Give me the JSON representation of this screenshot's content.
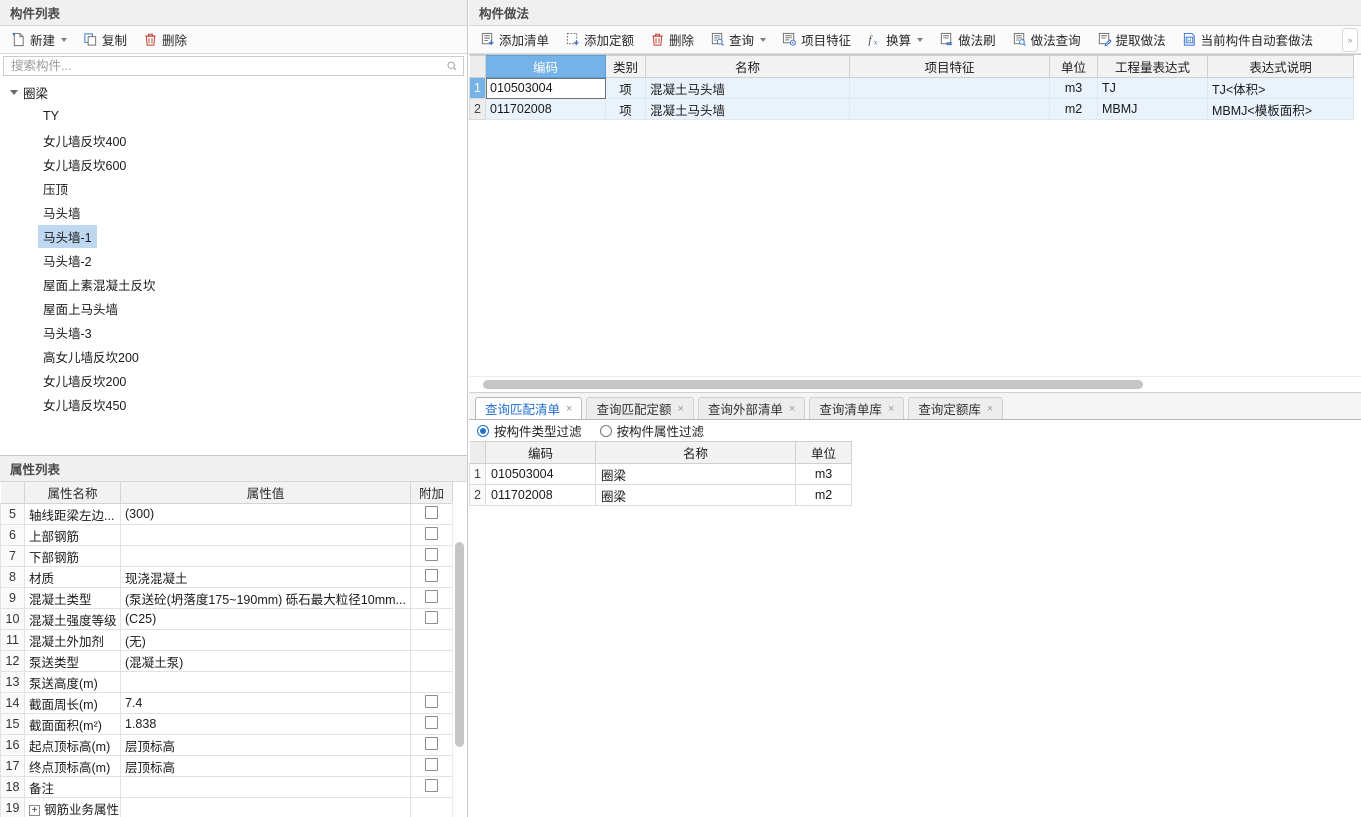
{
  "component_list": {
    "title": "构件列表",
    "toolbar": [
      {
        "label": "新建",
        "icon": "new-file-icon",
        "caret": true
      },
      {
        "label": "复制",
        "icon": "copy-icon",
        "caret": false
      },
      {
        "label": "删除",
        "icon": "trash-icon",
        "caret": false
      }
    ],
    "search": {
      "placeholder": "搜索构件...",
      "value": "",
      "icon": "search-icon"
    },
    "tree": {
      "root": "圈梁",
      "items": [
        "TY",
        "女儿墙反坎400",
        "女儿墙反坎600",
        "压顶",
        "马头墙",
        "马头墙-1",
        "马头墙-2",
        "屋面上素混凝土反坎",
        "屋面上马头墙",
        "马头墙-3",
        "高女儿墙反坎200",
        "女儿墙反坎200",
        "女儿墙反坎450"
      ],
      "selected_index": 5
    }
  },
  "property_list": {
    "title": "属性列表",
    "headers": [
      "",
      "属性名称",
      "属性值",
      "附加"
    ],
    "rows": [
      {
        "idx": "5",
        "name": "轴线距梁左边...",
        "link": false,
        "value": "(300)",
        "gray": false,
        "att": true
      },
      {
        "idx": "6",
        "name": "上部钢筋",
        "link": true,
        "value": "",
        "gray": false,
        "att": true
      },
      {
        "idx": "7",
        "name": "下部钢筋",
        "link": true,
        "value": "",
        "gray": false,
        "att": true
      },
      {
        "idx": "8",
        "name": "材质",
        "link": true,
        "value": "现浇混凝土",
        "gray": false,
        "att": true
      },
      {
        "idx": "9",
        "name": "混凝土类型",
        "link": true,
        "value": "(泵送砼(坍落度175~190mm) 砾石最大粒径10mm...",
        "gray": false,
        "att": true
      },
      {
        "idx": "10",
        "name": "混凝土强度等级",
        "link": true,
        "value": "(C25)",
        "gray": false,
        "att": true
      },
      {
        "idx": "11",
        "name": "混凝土外加剂",
        "link": true,
        "value": "(无)",
        "gray": false,
        "att": false
      },
      {
        "idx": "12",
        "name": "泵送类型",
        "link": true,
        "value": "(混凝土泵)",
        "gray": false,
        "att": false
      },
      {
        "idx": "13",
        "name": "泵送高度(m)",
        "link": false,
        "value": "",
        "gray": false,
        "att": false
      },
      {
        "idx": "14",
        "name": "截面周长(m)",
        "link": true,
        "value": "7.4",
        "gray": true,
        "att": true
      },
      {
        "idx": "15",
        "name": "截面面积(m²)",
        "link": true,
        "value": "1.838",
        "gray": true,
        "att": true
      },
      {
        "idx": "16",
        "name": "起点顶标高(m)",
        "link": false,
        "value": "层顶标高",
        "gray": false,
        "att": true
      },
      {
        "idx": "17",
        "name": "终点顶标高(m)",
        "link": false,
        "value": "层顶标高",
        "gray": false,
        "att": true
      },
      {
        "idx": "18",
        "name": "备注",
        "link": false,
        "value": "",
        "gray": false,
        "att": true
      },
      {
        "idx": "19",
        "name": "钢筋业务属性",
        "link": false,
        "value": "",
        "gray": false,
        "att": false,
        "expandable": true
      }
    ]
  },
  "component_method": {
    "title": "构件做法",
    "toolbar": [
      {
        "label": "添加清单",
        "icon": "add-list-icon",
        "caret": false
      },
      {
        "label": "添加定额",
        "icon": "add-quota-icon",
        "caret": false
      },
      {
        "label": "删除",
        "icon": "trash-icon",
        "caret": false
      },
      {
        "label": "查询",
        "icon": "query-icon",
        "caret": true
      },
      {
        "label": "项目特征",
        "icon": "feature-icon",
        "caret": false
      },
      {
        "label": "换算",
        "icon": "fx-icon",
        "caret": true
      },
      {
        "label": "做法刷",
        "icon": "method-brush-icon",
        "caret": false
      },
      {
        "label": "做法查询",
        "icon": "method-query-icon",
        "caret": false
      },
      {
        "label": "提取做法",
        "icon": "extract-method-icon",
        "caret": false
      },
      {
        "label": "当前构件自动套做法",
        "icon": "auto-method-icon",
        "caret": false
      }
    ],
    "overflow_label": "»",
    "grid": {
      "headers": [
        "编码",
        "类别",
        "名称",
        "项目特征",
        "单位",
        "工程量表达式",
        "表达式说明"
      ],
      "selected_header_index": 0,
      "rows": [
        {
          "idx": "1",
          "code": "010503004",
          "category": "项",
          "name": "混凝土马头墙",
          "feature": "",
          "unit": "m3",
          "expr": "TJ",
          "expr_desc": "TJ<体积>",
          "editing": true
        },
        {
          "idx": "2",
          "code": "011702008",
          "category": "项",
          "name": "混凝土马头墙",
          "feature": "",
          "unit": "m2",
          "expr": "MBMJ",
          "expr_desc": "MBMJ<模板面积>",
          "editing": false
        }
      ]
    }
  },
  "query_panel": {
    "tabs": [
      {
        "label": "查询匹配清单",
        "active": true
      },
      {
        "label": "查询匹配定额",
        "active": false
      },
      {
        "label": "查询外部清单",
        "active": false
      },
      {
        "label": "查询清单库",
        "active": false
      },
      {
        "label": "查询定额库",
        "active": false
      }
    ],
    "tab_close_glyph": "×",
    "filters": [
      {
        "label": "按构件类型过滤",
        "selected": true
      },
      {
        "label": "按构件属性过滤",
        "selected": false
      }
    ],
    "grid": {
      "headers": [
        "编码",
        "名称",
        "单位"
      ],
      "rows": [
        {
          "idx": "1",
          "code": "010503004",
          "name": "圈梁",
          "unit": "m3"
        },
        {
          "idx": "2",
          "code": "011702008",
          "name": "圈梁",
          "unit": "m2"
        }
      ]
    }
  },
  "colors": {
    "accent": "#1f6fd0",
    "header_select": "#74b2e8",
    "row_tint": "#eaf2fb",
    "tree_select": "#bed8f2"
  }
}
